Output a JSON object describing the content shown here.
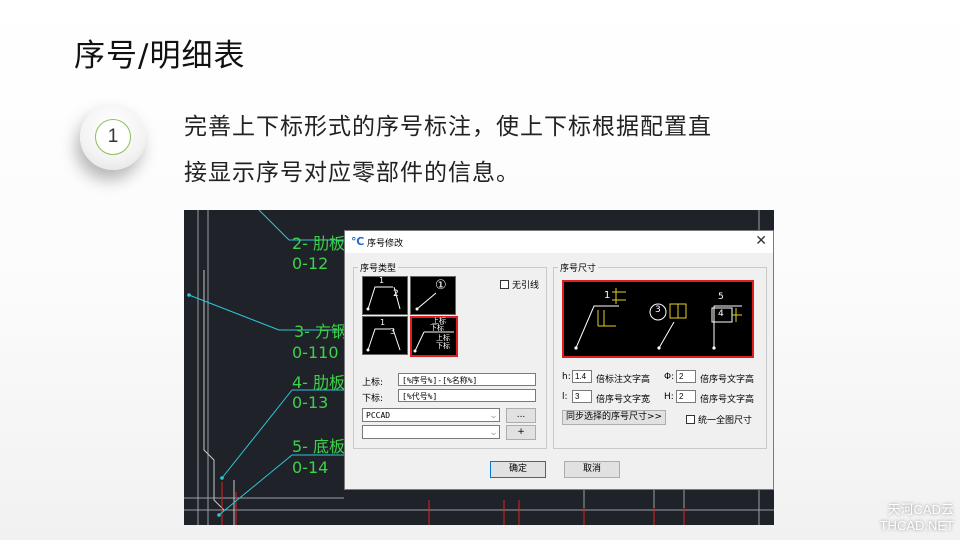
{
  "slide": {
    "title": "序号/明细表",
    "bullet_number": "1",
    "description_line1": "完善上下标形式的序号标注，使上下标根据配置直",
    "description_line2": "接显示序号对应零部件的信息。"
  },
  "cad_drawing": {
    "labels": [
      {
        "name": "2- 肋板"
      },
      {
        "name": "0-12"
      },
      {
        "name": "3- 方钢"
      },
      {
        "name": "0-110"
      },
      {
        "name": "4- 肋板"
      },
      {
        "name": "0-13"
      },
      {
        "name": "5- 底板"
      },
      {
        "name": "0-14"
      }
    ]
  },
  "dialog": {
    "title": "序号修改",
    "close_label": "✕",
    "type_group": {
      "label": "序号类型",
      "no_leader_label": "无引线",
      "no_leader_checked": false,
      "thumb_texts": {
        "t1_top": "1",
        "t1_side": "2",
        "t2_circle": "①",
        "t3_top": "1",
        "t3_side": "3",
        "t4_upper1": "上标",
        "t4_lower1": "下标",
        "t4_upper2": "上标",
        "t4_lower2": "下标"
      },
      "selected_index": 3,
      "upper_label": "上标:",
      "upper_value": "[%序号%]-[%名称%]",
      "lower_label": "下标:",
      "lower_value": "[%代号%]",
      "combo1_value": "PCCAD",
      "combo2_value": "",
      "more_button": "...",
      "add_button": "+"
    },
    "size_group": {
      "label": "序号尺寸",
      "preview_texts": {
        "p1_num": "1",
        "p2_num": "3",
        "p3_upper": "5",
        "p3_lower": "4"
      },
      "h_label": "h:",
      "h_value": "1.4",
      "h_desc": "倍标注文字高",
      "phi_label": "Φ:",
      "phi_value": "2",
      "phi_desc": "倍序号文字高",
      "l_label": "l:",
      "l_value": "3",
      "l_desc": "倍序号文字宽",
      "H_label": "H:",
      "H_value": "2",
      "H_desc": "倍序号文字高",
      "sync_button": "同步选择的序号尺寸>>",
      "unify_label": "统一全图尺寸",
      "unify_checked": false
    },
    "ok_button": "确定",
    "cancel_button": "取消"
  },
  "watermark": {
    "line1": "天河CAD云",
    "line2": "THCAD.NET"
  },
  "colors": {
    "cad_background": "#1f2228",
    "cad_green": "#3bd34a",
    "cad_cyan": "#2fc7d8",
    "highlight_red": "#e02020",
    "bullet_ring": "#8bbf5c"
  }
}
